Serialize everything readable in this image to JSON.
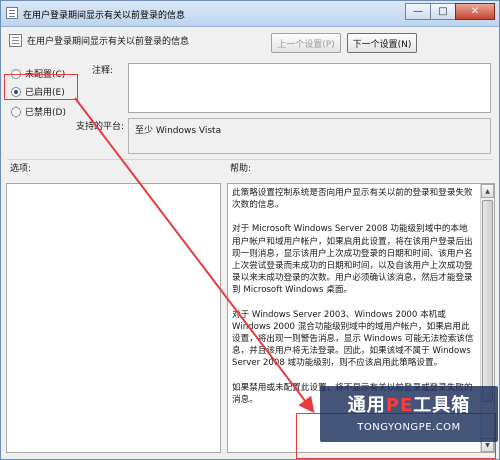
{
  "window": {
    "title": "在用户登录期间显示有关以前登录的信息",
    "minimize": "—",
    "maximize": "□",
    "close": "✕"
  },
  "header": {
    "policy_title": "在用户登录期间显示有关以前登录的信息",
    "prev_button": "上一个设置(P)",
    "next_button": "下一个设置(N)"
  },
  "state": {
    "not_configured": "未配置(C)",
    "enabled": "已启用(E)",
    "disabled": "已禁用(D)",
    "selected": "enabled"
  },
  "notes": {
    "label": "注释:",
    "value": ""
  },
  "platform": {
    "label": "支持的平台:",
    "value": "至少 Windows Vista"
  },
  "options": {
    "label": "选项:"
  },
  "help": {
    "label": "帮助:",
    "paragraphs": [
      "此策略设置控制系统是否向用户显示有关以前的登录和登录失败次数的信息。",
      "对于 Microsoft Windows Server 2008 功能级别域中的本地用户帐户和域用户帐户，如果启用此设置，将在该用户登录后出现一则消息，显示该用户上次成功登录的日期和时间、该用户名上次尝试登录而未成功的日期和时间，以及自该用户上次成功登录以来未成功登录的次数。用户必须确认该消息，然后才能登录到 Microsoft Windows 桌面。",
      "对于 Windows Server 2003、Windows 2000 本机或 Windows 2000 混合功能级别域中的域用户帐户，如果启用此设置，将出现一则警告消息，显示 Windows 可能无法检索该信息，并且该用户将无法登录。因此，如果该域不属于 Windows Server 2008 域功能级别，则不应该启用此策略设置。",
      "如果禁用或未配置此设置，将不显示有关以前登录或登录失败的消息。"
    ]
  },
  "watermark": {
    "title_part1": "通用",
    "title_accent": "PE",
    "title_part2": "工具箱",
    "subtitle": "TONGYONGPE.COM"
  },
  "colors": {
    "annotation_red": "#e53d3d",
    "accent": "#ff3a3a"
  }
}
